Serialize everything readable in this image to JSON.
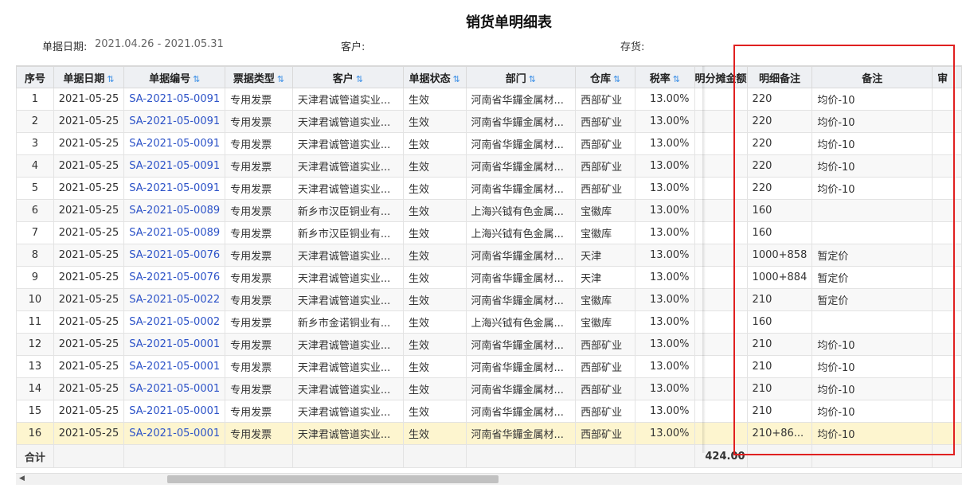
{
  "report": {
    "title": "销货单明细表",
    "filters": {
      "date_label": "单据日期:",
      "date_value": "2021.04.26 - 2021.05.31",
      "customer_label": "客户:",
      "stock_label": "存货:"
    }
  },
  "grid": {
    "headers": {
      "seq": "序号",
      "date": "单据日期",
      "no": "单据编号",
      "type": "票据类型",
      "customer": "客户",
      "status": "单据状态",
      "dept": "部门",
      "warehouse": "仓库",
      "tax": "税率",
      "alloc": "明分摊金额",
      "detail_note": "明细备注",
      "note": "备注",
      "extra": "审"
    },
    "rows": [
      {
        "seq": "1",
        "date": "2021-05-25",
        "no": "SA-2021-05-0091",
        "type": "专用发票",
        "customer": "天津君诚管道实业...",
        "status": "生效",
        "dept": "河南省华鑼金属材...",
        "warehouse": "西部矿业",
        "tax": "13.00%",
        "detail_note": "220",
        "note": "均价-10"
      },
      {
        "seq": "2",
        "date": "2021-05-25",
        "no": "SA-2021-05-0091",
        "type": "专用发票",
        "customer": "天津君诚管道实业...",
        "status": "生效",
        "dept": "河南省华鑼金属材...",
        "warehouse": "西部矿业",
        "tax": "13.00%",
        "detail_note": "220",
        "note": "均价-10"
      },
      {
        "seq": "3",
        "date": "2021-05-25",
        "no": "SA-2021-05-0091",
        "type": "专用发票",
        "customer": "天津君诚管道实业...",
        "status": "生效",
        "dept": "河南省华鑼金属材...",
        "warehouse": "西部矿业",
        "tax": "13.00%",
        "detail_note": "220",
        "note": "均价-10"
      },
      {
        "seq": "4",
        "date": "2021-05-25",
        "no": "SA-2021-05-0091",
        "type": "专用发票",
        "customer": "天津君诚管道实业...",
        "status": "生效",
        "dept": "河南省华鑼金属材...",
        "warehouse": "西部矿业",
        "tax": "13.00%",
        "detail_note": "220",
        "note": "均价-10"
      },
      {
        "seq": "5",
        "date": "2021-05-25",
        "no": "SA-2021-05-0091",
        "type": "专用发票",
        "customer": "天津君诚管道实业...",
        "status": "生效",
        "dept": "河南省华鑼金属材...",
        "warehouse": "西部矿业",
        "tax": "13.00%",
        "detail_note": "220",
        "note": "均价-10"
      },
      {
        "seq": "6",
        "date": "2021-05-25",
        "no": "SA-2021-05-0089",
        "type": "专用发票",
        "customer": "新乡市汉臣铜业有...",
        "status": "生效",
        "dept": "上海兴钺有色金属...",
        "warehouse": "宝徽库",
        "tax": "13.00%",
        "detail_note": "160",
        "note": ""
      },
      {
        "seq": "7",
        "date": "2021-05-25",
        "no": "SA-2021-05-0089",
        "type": "专用发票",
        "customer": "新乡市汉臣铜业有...",
        "status": "生效",
        "dept": "上海兴钺有色金属...",
        "warehouse": "宝徽库",
        "tax": "13.00%",
        "detail_note": "160",
        "note": ""
      },
      {
        "seq": "8",
        "date": "2021-05-25",
        "no": "SA-2021-05-0076",
        "type": "专用发票",
        "customer": "天津君诚管道实业...",
        "status": "生效",
        "dept": "河南省华鑼金属材...",
        "warehouse": "天津",
        "tax": "13.00%",
        "detail_note": "1000+858",
        "note": "暂定价"
      },
      {
        "seq": "9",
        "date": "2021-05-25",
        "no": "SA-2021-05-0076",
        "type": "专用发票",
        "customer": "天津君诚管道实业...",
        "status": "生效",
        "dept": "河南省华鑼金属材...",
        "warehouse": "天津",
        "tax": "13.00%",
        "detail_note": "1000+884",
        "note": "暂定价"
      },
      {
        "seq": "10",
        "date": "2021-05-25",
        "no": "SA-2021-05-0022",
        "type": "专用发票",
        "customer": "天津君诚管道实业...",
        "status": "生效",
        "dept": "河南省华鑼金属材...",
        "warehouse": "宝徽库",
        "tax": "13.00%",
        "detail_note": "210",
        "note": "暂定价"
      },
      {
        "seq": "11",
        "date": "2021-05-25",
        "no": "SA-2021-05-0002",
        "type": "专用发票",
        "customer": "新乡市金诺铜业有...",
        "status": "生效",
        "dept": "上海兴钺有色金属...",
        "warehouse": "宝徽库",
        "tax": "13.00%",
        "detail_note": "160",
        "note": ""
      },
      {
        "seq": "12",
        "date": "2021-05-25",
        "no": "SA-2021-05-0001",
        "type": "专用发票",
        "customer": "天津君诚管道实业...",
        "status": "生效",
        "dept": "河南省华鑼金属材...",
        "warehouse": "西部矿业",
        "tax": "13.00%",
        "detail_note": "210",
        "note": "均价-10"
      },
      {
        "seq": "13",
        "date": "2021-05-25",
        "no": "SA-2021-05-0001",
        "type": "专用发票",
        "customer": "天津君诚管道实业...",
        "status": "生效",
        "dept": "河南省华鑼金属材...",
        "warehouse": "西部矿业",
        "tax": "13.00%",
        "detail_note": "210",
        "note": "均价-10"
      },
      {
        "seq": "14",
        "date": "2021-05-25",
        "no": "SA-2021-05-0001",
        "type": "专用发票",
        "customer": "天津君诚管道实业...",
        "status": "生效",
        "dept": "河南省华鑼金属材...",
        "warehouse": "西部矿业",
        "tax": "13.00%",
        "detail_note": "210",
        "note": "均价-10"
      },
      {
        "seq": "15",
        "date": "2021-05-25",
        "no": "SA-2021-05-0001",
        "type": "专用发票",
        "customer": "天津君诚管道实业...",
        "status": "生效",
        "dept": "河南省华鑼金属材...",
        "warehouse": "西部矿业",
        "tax": "13.00%",
        "detail_note": "210",
        "note": "均价-10"
      },
      {
        "seq": "16",
        "date": "2021-05-25",
        "no": "SA-2021-05-0001",
        "type": "专用发票",
        "customer": "天津君诚管道实业...",
        "status": "生效",
        "dept": "河南省华鑼金属材...",
        "warehouse": "西部矿业",
        "tax": "13.00%",
        "detail_note": "210+86...",
        "note": "均价-10"
      }
    ],
    "selected_row": 15,
    "footer": {
      "label": "合计",
      "alloc_total": "424.00"
    }
  },
  "icons": {
    "sort": "sort-icon"
  },
  "colors": {
    "link": "#2d53c8",
    "selected_row": "#fdf5cf",
    "highlight_box": "#e02020"
  }
}
